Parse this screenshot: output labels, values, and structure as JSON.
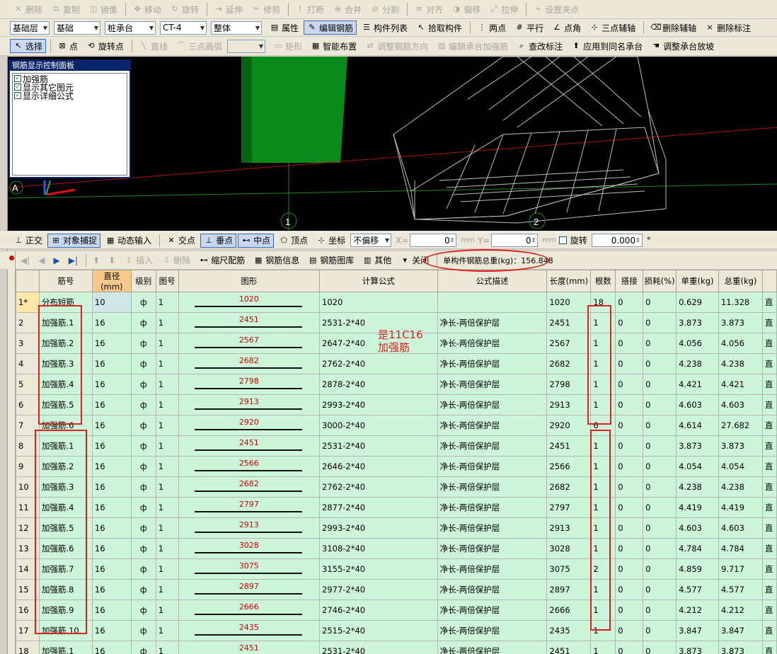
{
  "toolbar1": [
    {
      "label": "删除",
      "icon": "delete-icon"
    },
    {
      "label": "复制",
      "icon": "copy-icon"
    },
    {
      "label": "镜像",
      "icon": "mirror-icon"
    },
    {
      "label": "移动",
      "icon": "move-icon"
    },
    {
      "label": "旋转",
      "icon": "rotate-icon"
    },
    {
      "label": "延伸",
      "icon": "extend-icon"
    },
    {
      "label": "修剪",
      "icon": "trim-icon"
    },
    {
      "label": "打断",
      "icon": "break-icon"
    },
    {
      "label": "合并",
      "icon": "merge-icon"
    },
    {
      "label": "分割",
      "icon": "split-icon"
    },
    {
      "label": "对齐",
      "icon": "align-icon"
    },
    {
      "label": "偏移",
      "icon": "offset-icon"
    },
    {
      "label": "拉伸",
      "icon": "stretch-icon"
    },
    {
      "label": "设置夹点",
      "icon": "grip-icon"
    }
  ],
  "toolbar2": {
    "selects": [
      "基础层",
      "基础",
      "桩承台",
      "CT-4",
      "整体"
    ],
    "buttons": [
      {
        "label": "属性",
        "icon": "property-icon"
      },
      {
        "label": "编辑钢筋",
        "icon": "edit-rebar-icon"
      },
      {
        "label": "构件列表",
        "icon": "list-icon"
      },
      {
        "label": "拾取构件",
        "icon": "pick-icon"
      },
      {
        "label": "两点",
        "icon": "two-point-icon"
      },
      {
        "label": "平行",
        "icon": "parallel-icon"
      },
      {
        "label": "点角",
        "icon": "point-angle-icon"
      },
      {
        "label": "三点辅轴",
        "icon": "three-point-axis-icon"
      },
      {
        "label": "删除辅轴",
        "icon": "delete-axis-icon"
      },
      {
        "label": "删除标注",
        "icon": "delete-mark-icon"
      }
    ]
  },
  "toolbar3": [
    {
      "label": "选择",
      "icon": "select-icon"
    },
    {
      "label": "点",
      "icon": "point-icon"
    },
    {
      "label": "旋转点",
      "icon": "rotate-point-icon"
    },
    {
      "label": "直线",
      "icon": "line-icon"
    },
    {
      "label": "三点画弧",
      "icon": "arc-icon"
    },
    {
      "label": "矩形",
      "icon": "rect-icon"
    },
    {
      "label": "智能布置",
      "icon": "smart-layout-icon"
    },
    {
      "label": "调整钢筋方向",
      "icon": "adjust-dir-icon"
    },
    {
      "label": "编辑承台加强筋",
      "icon": "edit-strengthen-icon"
    },
    {
      "label": "查改标注",
      "icon": "check-mark-icon"
    },
    {
      "label": "应用到同名承台",
      "icon": "apply-same-icon"
    },
    {
      "label": "调整承台放坡",
      "icon": "adjust-slope-icon"
    }
  ],
  "panel": {
    "title": "钢筋显示控制面板",
    "items": [
      "加强筋",
      "显示其它图元",
      "显示详细公式"
    ]
  },
  "viewport": {
    "axis_a": "A",
    "axis_1": "1",
    "axis_2": "2"
  },
  "toolbar4": {
    "buttons": [
      "正交",
      "对象捕捉",
      "动态输入",
      "交点",
      "垂点",
      "中点",
      "顶点",
      "坐标"
    ],
    "offset": "不偏移",
    "x_label": "X=",
    "x_value": "0",
    "y_label": "Y=",
    "y_value": "0",
    "unit": "mm",
    "rotate_label": "旋转",
    "rotate_value": "0.000",
    "deg": "°"
  },
  "toolbar5": {
    "buttons": [
      "插入",
      "删除",
      "缩尺配筋",
      "钢筋信息",
      "钢筋图库",
      "其他",
      "关闭"
    ],
    "total_label": "单构件钢筋总重(kg)：156.848"
  },
  "table": {
    "headers": [
      "筋号",
      "直径(mm)",
      "级别",
      "图号",
      "图形",
      "计算公式",
      "公式描述",
      "长度(mm)",
      "根数",
      "搭接",
      "损耗(%)",
      "单重(kg)",
      "总重(kg)",
      ""
    ],
    "grade": "ф",
    "rows": [
      {
        "n": "1*",
        "name": "分布短筋",
        "d": "10",
        "fig": "1",
        "shape": "1020",
        "formula": "1020",
        "desc": "",
        "len": "1020",
        "cnt": "18",
        "lap": "0",
        "loss": "0",
        "uw": "0.629",
        "tw": "11.328",
        "x": "直"
      },
      {
        "n": "2",
        "name": "加强筋.1",
        "d": "16",
        "fig": "1",
        "shape": "2451",
        "formula": "2531-2*40",
        "desc": "净长-两倍保护层",
        "len": "2451",
        "cnt": "1",
        "lap": "0",
        "loss": "0",
        "uw": "3.873",
        "tw": "3.873",
        "x": "直"
      },
      {
        "n": "3",
        "name": "加强筋.2",
        "d": "16",
        "fig": "1",
        "shape": "2567",
        "formula": "2647-2*40",
        "desc": "净长-两倍保护层",
        "len": "2567",
        "cnt": "1",
        "lap": "0",
        "loss": "0",
        "uw": "4.056",
        "tw": "4.056",
        "x": "直"
      },
      {
        "n": "4",
        "name": "加强筋.3",
        "d": "16",
        "fig": "1",
        "shape": "2682",
        "formula": "2762-2*40",
        "desc": "净长-两倍保护层",
        "len": "2682",
        "cnt": "1",
        "lap": "0",
        "loss": "0",
        "uw": "4.238",
        "tw": "4.238",
        "x": "直"
      },
      {
        "n": "5",
        "name": "加强筋.4",
        "d": "16",
        "fig": "1",
        "shape": "2798",
        "formula": "2878-2*40",
        "desc": "净长-两倍保护层",
        "len": "2798",
        "cnt": "1",
        "lap": "0",
        "loss": "0",
        "uw": "4.421",
        "tw": "4.421",
        "x": "直"
      },
      {
        "n": "6",
        "name": "加强筋.5",
        "d": "16",
        "fig": "1",
        "shape": "2913",
        "formula": "2993-2*40",
        "desc": "净长-两倍保护层",
        "len": "2913",
        "cnt": "1",
        "lap": "0",
        "loss": "0",
        "uw": "4.603",
        "tw": "4.603",
        "x": "直"
      },
      {
        "n": "7",
        "name": "加强筋.6",
        "d": "16",
        "fig": "1",
        "shape": "2920",
        "formula": "3000-2*40",
        "desc": "净长-两倍保护层",
        "len": "2920",
        "cnt": "6",
        "lap": "0",
        "loss": "0",
        "uw": "4.614",
        "tw": "27.682",
        "x": "直"
      },
      {
        "n": "8",
        "name": "加强筋.1",
        "d": "16",
        "fig": "1",
        "shape": "2451",
        "formula": "2531-2*40",
        "desc": "净长-两倍保护层",
        "len": "2451",
        "cnt": "1",
        "lap": "0",
        "loss": "0",
        "uw": "3.873",
        "tw": "3.873",
        "x": "直"
      },
      {
        "n": "9",
        "name": "加强筋.2",
        "d": "16",
        "fig": "1",
        "shape": "2566",
        "formula": "2646-2*40",
        "desc": "净长-两倍保护层",
        "len": "2566",
        "cnt": "1",
        "lap": "0",
        "loss": "0",
        "uw": "4.054",
        "tw": "4.054",
        "x": "直"
      },
      {
        "n": "10",
        "name": "加强筋.3",
        "d": "16",
        "fig": "1",
        "shape": "2682",
        "formula": "2762-2*40",
        "desc": "净长-两倍保护层",
        "len": "2682",
        "cnt": "1",
        "lap": "0",
        "loss": "0",
        "uw": "4.238",
        "tw": "4.238",
        "x": "直"
      },
      {
        "n": "11",
        "name": "加强筋.4",
        "d": "16",
        "fig": "1",
        "shape": "2797",
        "formula": "2877-2*40",
        "desc": "净长-两倍保护层",
        "len": "2797",
        "cnt": "1",
        "lap": "0",
        "loss": "0",
        "uw": "4.419",
        "tw": "4.419",
        "x": "直"
      },
      {
        "n": "12",
        "name": "加强筋.5",
        "d": "16",
        "fig": "1",
        "shape": "2913",
        "formula": "2993-2*40",
        "desc": "净长-两倍保护层",
        "len": "2913",
        "cnt": "1",
        "lap": "0",
        "loss": "0",
        "uw": "4.603",
        "tw": "4.603",
        "x": "直"
      },
      {
        "n": "13",
        "name": "加强筋.6",
        "d": "16",
        "fig": "1",
        "shape": "3028",
        "formula": "3108-2*40",
        "desc": "净长-两倍保护层",
        "len": "3028",
        "cnt": "1",
        "lap": "0",
        "loss": "0",
        "uw": "4.784",
        "tw": "4.784",
        "x": "直"
      },
      {
        "n": "14",
        "name": "加强筋.7",
        "d": "16",
        "fig": "1",
        "shape": "3075",
        "formula": "3155-2*40",
        "desc": "净长-两倍保护层",
        "len": "3075",
        "cnt": "2",
        "lap": "0",
        "loss": "0",
        "uw": "4.859",
        "tw": "9.717",
        "x": "直"
      },
      {
        "n": "15",
        "name": "加强筋.8",
        "d": "16",
        "fig": "1",
        "shape": "2897",
        "formula": "2977-2*40",
        "desc": "净长-两倍保护层",
        "len": "2897",
        "cnt": "1",
        "lap": "0",
        "loss": "0",
        "uw": "4.577",
        "tw": "4.577",
        "x": "直"
      },
      {
        "n": "16",
        "name": "加强筋.9",
        "d": "16",
        "fig": "1",
        "shape": "2666",
        "formula": "2746-2*40",
        "desc": "净长-两倍保护层",
        "len": "2666",
        "cnt": "1",
        "lap": "0",
        "loss": "0",
        "uw": "4.212",
        "tw": "4.212",
        "x": "直"
      },
      {
        "n": "17",
        "name": "加强筋.10",
        "d": "16",
        "fig": "1",
        "shape": "2435",
        "formula": "2515-2*40",
        "desc": "净长-两倍保护层",
        "len": "2435",
        "cnt": "1",
        "lap": "0",
        "loss": "0",
        "uw": "3.847",
        "tw": "3.847",
        "x": "直"
      },
      {
        "n": "18",
        "name": "加强筋.1",
        "d": "16",
        "fig": "1",
        "shape": "2451",
        "formula": "2531-2*40",
        "desc": "净长-两倍保护层",
        "len": "2451",
        "cnt": "1",
        "lap": "0",
        "loss": "0",
        "uw": "3.873",
        "tw": "3.873",
        "x": "直"
      }
    ]
  },
  "annotation": {
    "line1": "是11C16",
    "line2": "加强筋"
  },
  "colors": {
    "grid_bg": "#ccf5d9",
    "highlight": "#e02020",
    "viewport_bg": "#000000"
  }
}
